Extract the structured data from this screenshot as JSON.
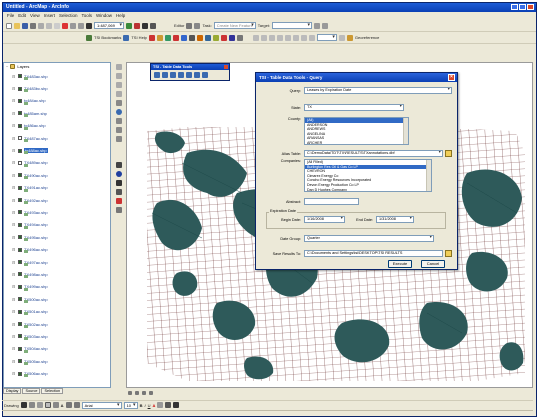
{
  "window": {
    "title": "Untitled - ArcMap - ArcInfo"
  },
  "menu": [
    "File",
    "Edit",
    "View",
    "Insert",
    "Selection",
    "Tools",
    "Window",
    "Help"
  ],
  "toolbar": {
    "scale": "1:487,069",
    "editor_label": "Editor",
    "task_label": "Task:",
    "task_value": "Create New Feature",
    "target_label": "Target:",
    "tsi_bookmarks": "TSI Bookmarks",
    "tsi_help": "TSI Help",
    "georeferencing": "Georeference"
  },
  "toc": {
    "root_label": "Layers",
    "layers": [
      {
        "name": "TX483ac.shp",
        "checked": true,
        "selected": false
      },
      {
        "name": "TX483bc.shp",
        "checked": true,
        "selected": false
      },
      {
        "name": "tx484ac.shp",
        "checked": true,
        "selected": false
      },
      {
        "name": "tx485am.shp",
        "checked": true,
        "selected": false
      },
      {
        "name": "tx486ac.shp",
        "checked": true,
        "selected": false
      },
      {
        "name": "TX487ac.shp",
        "checked": false,
        "selected": false
      },
      {
        "name": "tx488ac.shp",
        "checked": true,
        "selected": true
      },
      {
        "name": "TX489ac.shp",
        "checked": false,
        "selected": false
      },
      {
        "name": "TX490ac.shp",
        "checked": true,
        "selected": false
      },
      {
        "name": "TX491ac.shp",
        "checked": true,
        "selected": false
      },
      {
        "name": "TX492ac.shp",
        "checked": true,
        "selected": false
      },
      {
        "name": "TX493ac.shp",
        "checked": true,
        "selected": false
      },
      {
        "name": "TX494ac.shp",
        "checked": true,
        "selected": false
      },
      {
        "name": "TX495ac.shp",
        "checked": true,
        "selected": false
      },
      {
        "name": "TX496ac.shp",
        "checked": true,
        "selected": false
      },
      {
        "name": "TX497ac.shp",
        "checked": true,
        "selected": false
      },
      {
        "name": "TX498ac.shp",
        "checked": true,
        "selected": false
      },
      {
        "name": "TX499ac.shp",
        "checked": true,
        "selected": false
      },
      {
        "name": "TX500ac.shp",
        "checked": true,
        "selected": false
      },
      {
        "name": "TX501ac.shp",
        "checked": true,
        "selected": false
      },
      {
        "name": "TX502ac.shp",
        "checked": true,
        "selected": false
      },
      {
        "name": "TX503ac.shp",
        "checked": true,
        "selected": false
      },
      {
        "name": "TX504ac.shp",
        "checked": true,
        "selected": false
      },
      {
        "name": "TX505ac.shp",
        "checked": true,
        "selected": false
      },
      {
        "name": "TX506ac.shp",
        "checked": true,
        "selected": false
      }
    ],
    "tabs": [
      "Display",
      "Source",
      "Selection"
    ]
  },
  "floatbar": {
    "title": "TSI - Table Data Tools"
  },
  "dialog": {
    "title": "TSI - Table Data Tools - Query",
    "query_label": "Query:",
    "query_value": "Leases by Expiration Date",
    "state_label": "State:",
    "state_value": "TX",
    "county_label": "County:",
    "county_items": [
      "(All)",
      "ANDERSON",
      "ANDREWS",
      "ANGELINA",
      "ARANSAS",
      "ARCHER"
    ],
    "county_selected": 0,
    "alias_label": "Alias Table:",
    "alias_value": "C:\\DemoData\\TDT\\TX\\RESULTS\\TXannotations.dbf",
    "companies_label": "Companies:",
    "company_items": [
      "(All Filled)",
      "Burlington Res Oil & Gas Co LP",
      "CHEVRON",
      "Cimarex Energy Co",
      "Concho Energy Resources Incorporated",
      "Devon Energy Production Co LP",
      "Dan D Hughes Company"
    ],
    "company_selected": 1,
    "abstract_label": "Abstract:",
    "abstract_value": "",
    "exp_group_label": "Expiration Date",
    "begin_label": "Begin Date:",
    "begin_value": "1/16/2008",
    "end_label": "End Date:",
    "end_value": "1/31/2008",
    "date_group_label": "Date Group:",
    "date_group_value": "Quarter",
    "save_label": "Save Results To:",
    "save_value": "C:\\Documents and Settings\\tsi\\DESKTOP\\TSI RESULTS",
    "execute_label": "Execute",
    "cancel_label": "Cancel"
  },
  "drawing": {
    "drawing_label": "Drawing",
    "font_value": "Arial",
    "size_value": "10",
    "bold": "B",
    "italic": "I",
    "underline": "U",
    "text_a": "A"
  },
  "colors": {
    "title_blue": "#0a3fb4",
    "teal_map": "#2e5a5a",
    "grid_red": "#8a2a2a",
    "selection_blue": "#316ac5"
  }
}
